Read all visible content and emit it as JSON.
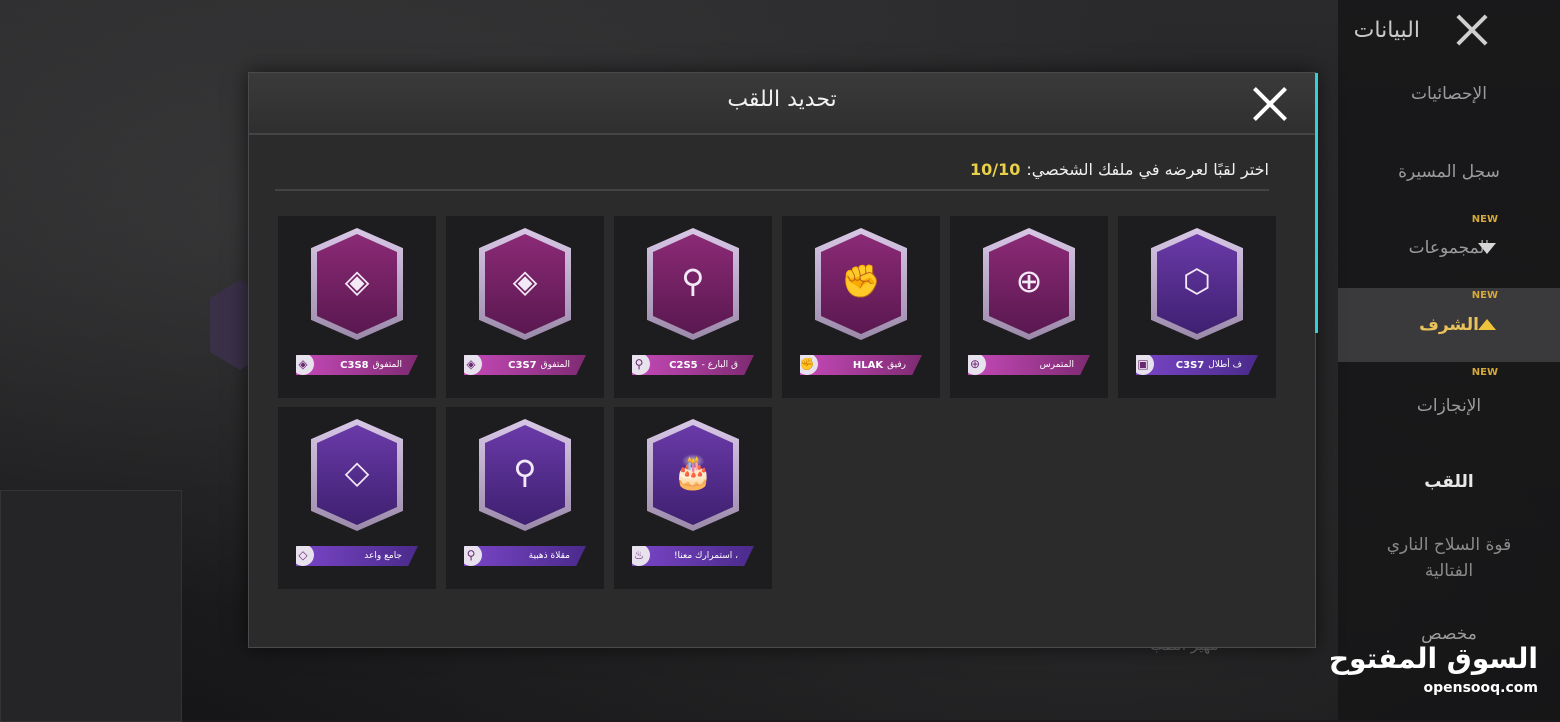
{
  "sidebar": {
    "title": "البيانات",
    "items": [
      {
        "label": "الإحصائيات",
        "new": ""
      },
      {
        "label": "سجل المسيرة",
        "new": ""
      },
      {
        "label": "المجموعات",
        "new": "NEW"
      },
      {
        "label": "الشرف",
        "new": "NEW"
      },
      {
        "label": "الإنجازات",
        "new": "NEW"
      },
      {
        "label": "اللقب",
        "new": ""
      },
      {
        "label": "قوة السلاح الناري الفتالية",
        "new": ""
      },
      {
        "label": "مخصص",
        "new": ""
      }
    ]
  },
  "dialog": {
    "title": "تحديد اللقب",
    "instruction": "اختر لقبًا لعرضه في ملفك الشخصي:",
    "count": "10/10"
  },
  "titles": [
    {
      "name": "ف أطلال",
      "code": "C3S7",
      "icon": "book-icon",
      "color": "purple"
    },
    {
      "name": "المتمرس",
      "code": "",
      "icon": "crosshair-icon",
      "color": "pink"
    },
    {
      "name": "رفيق",
      "code": "HLAK",
      "icon": "handshake-icon",
      "color": "pink"
    },
    {
      "name": "ق البارع -",
      "code": "C2S5",
      "icon": "pin-icon",
      "color": "pink"
    },
    {
      "name": "المتفوق",
      "code": "C3S7",
      "icon": "gem-icon",
      "color": "pink"
    },
    {
      "name": "المتفوق",
      "code": "C3S8",
      "icon": "gem-icon",
      "color": "pink"
    },
    {
      "name": "، استمرارك معنا!",
      "code": "",
      "icon": "cake-icon",
      "color": "purple"
    },
    {
      "name": "مقلاة ذهبية",
      "code": "",
      "icon": "pan-icon",
      "color": "purple"
    },
    {
      "name": "جامع واعد",
      "code": "",
      "icon": "diamond-icon",
      "color": "purple"
    }
  ],
  "bottom_hint": "مهيز اللقب",
  "watermark": {
    "arabic": "السوق المفتوح",
    "latin": "opensooq.com"
  }
}
